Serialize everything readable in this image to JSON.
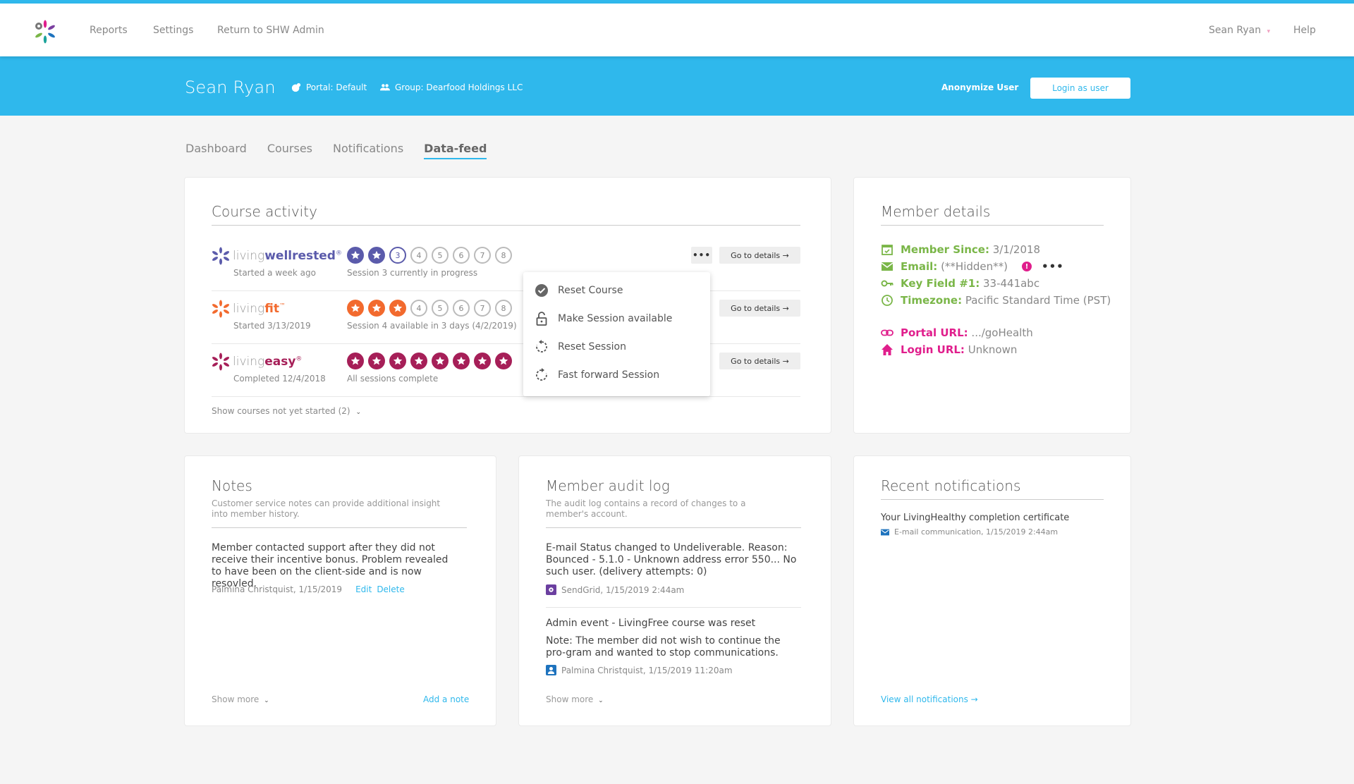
{
  "nav": {
    "links": [
      "Reports",
      "Settings",
      "Return to SHW Admin"
    ],
    "user_menu": "Sean Ryan",
    "help": "Help"
  },
  "member_header": {
    "name": "Sean Ryan",
    "portal": "Portal: Default",
    "group": "Group: Dearfood Holdings LLC",
    "anonymize": "Anonymize User",
    "login_as": "Login as user"
  },
  "tabs": [
    {
      "label": "Dashboard",
      "active": false
    },
    {
      "label": "Courses",
      "active": false
    },
    {
      "label": "Notifications",
      "active": false
    },
    {
      "label": "Data-feed",
      "active": true
    }
  ],
  "course_activity": {
    "title": "Course activity",
    "courses": [
      {
        "prefix": "living",
        "name": "wellrested",
        "mark": "®",
        "color": "#5b5bab",
        "subtitle": "Started a week ago",
        "total": 8,
        "completed": 2,
        "current": 3,
        "status": "Session 3 currently in progress"
      },
      {
        "prefix": "living",
        "name": "fit",
        "mark": "™",
        "color": "#f26a2e",
        "subtitle": "Started 3/13/2019",
        "total": 8,
        "completed": 3,
        "current": null,
        "status": "Session 4 available in 3 days (4/2/2019)"
      },
      {
        "prefix": "living",
        "name": "easy",
        "mark": "®",
        "color": "#a61f58",
        "subtitle": "Completed 12/4/2018",
        "total": 8,
        "completed": 8,
        "current": null,
        "status": "All sessions complete"
      }
    ],
    "more_label": "•••",
    "details_label": "Go to details →",
    "show_not_started": "Show courses not yet started (2)",
    "menu": [
      {
        "label": "Reset Course",
        "icon": "check-circle-icon"
      },
      {
        "label": "Make Session available",
        "icon": "unlock-icon"
      },
      {
        "label": "Reset Session",
        "icon": "reset-icon"
      },
      {
        "label": "Fast forward Session",
        "icon": "fast-forward-icon"
      }
    ]
  },
  "member_details": {
    "title": "Member details",
    "rows": [
      {
        "label": "Member Since:",
        "value": "3/1/2018",
        "icon": "calendar-icon"
      },
      {
        "label": "Email:",
        "value": "(**Hidden**)",
        "icon": "mail-icon"
      },
      {
        "label": "Key Field #1:",
        "value": "33-441abc",
        "icon": "key-icon"
      },
      {
        "label": "Timezone:",
        "value": "Pacific Standard Time (PST)",
        "icon": "clock-icon"
      }
    ],
    "links": [
      {
        "label": "Portal URL:",
        "value": ".../goHealth",
        "icon": "link-icon"
      },
      {
        "label": "Login URL:",
        "value": "Unknown",
        "icon": "home-icon"
      }
    ],
    "email_alert": "!",
    "email_more": "•••"
  },
  "notes": {
    "title": "Notes",
    "subtitle": "Customer service notes can provide additional insight into member history.",
    "entries": [
      {
        "text": "Member contacted support after they did not receive their incentive bonus. Problem revealed to have been on the client-side and is now resovled.",
        "meta": "Palmina Christquist, 1/15/2019",
        "edit": "Edit",
        "delete": "Delete"
      }
    ],
    "show_more": "Show more",
    "add_note": "Add a note"
  },
  "audit_log": {
    "title": "Member audit log",
    "subtitle": "The audit log contains a record of changes to a member's account.",
    "entries": [
      {
        "title": "E-mail Status changed to Undeliverable. Reason: Bounced - 5.1.0 - Unknown address error 550... No such user. (delivery attempts: 0)",
        "note": "",
        "meta": "SendGrid, 1/15/2019 2:44am",
        "icon": "sendgrid-icon"
      },
      {
        "title": "Admin event - LivingFree course was reset",
        "note": "Note: The member did not wish to continue the pro-gram and wanted to stop communications.",
        "meta": "Palmina Christquist, 1/15/2019 11:20am",
        "icon": "user-icon"
      }
    ],
    "show_more": "Show more"
  },
  "notifications": {
    "title": "Recent notifications",
    "items": [
      {
        "title": "Your LivingHealthy completion certificate",
        "meta": "E-mail communication, 1/15/2019 2:44am"
      }
    ],
    "view_all": "View all notifications →"
  }
}
